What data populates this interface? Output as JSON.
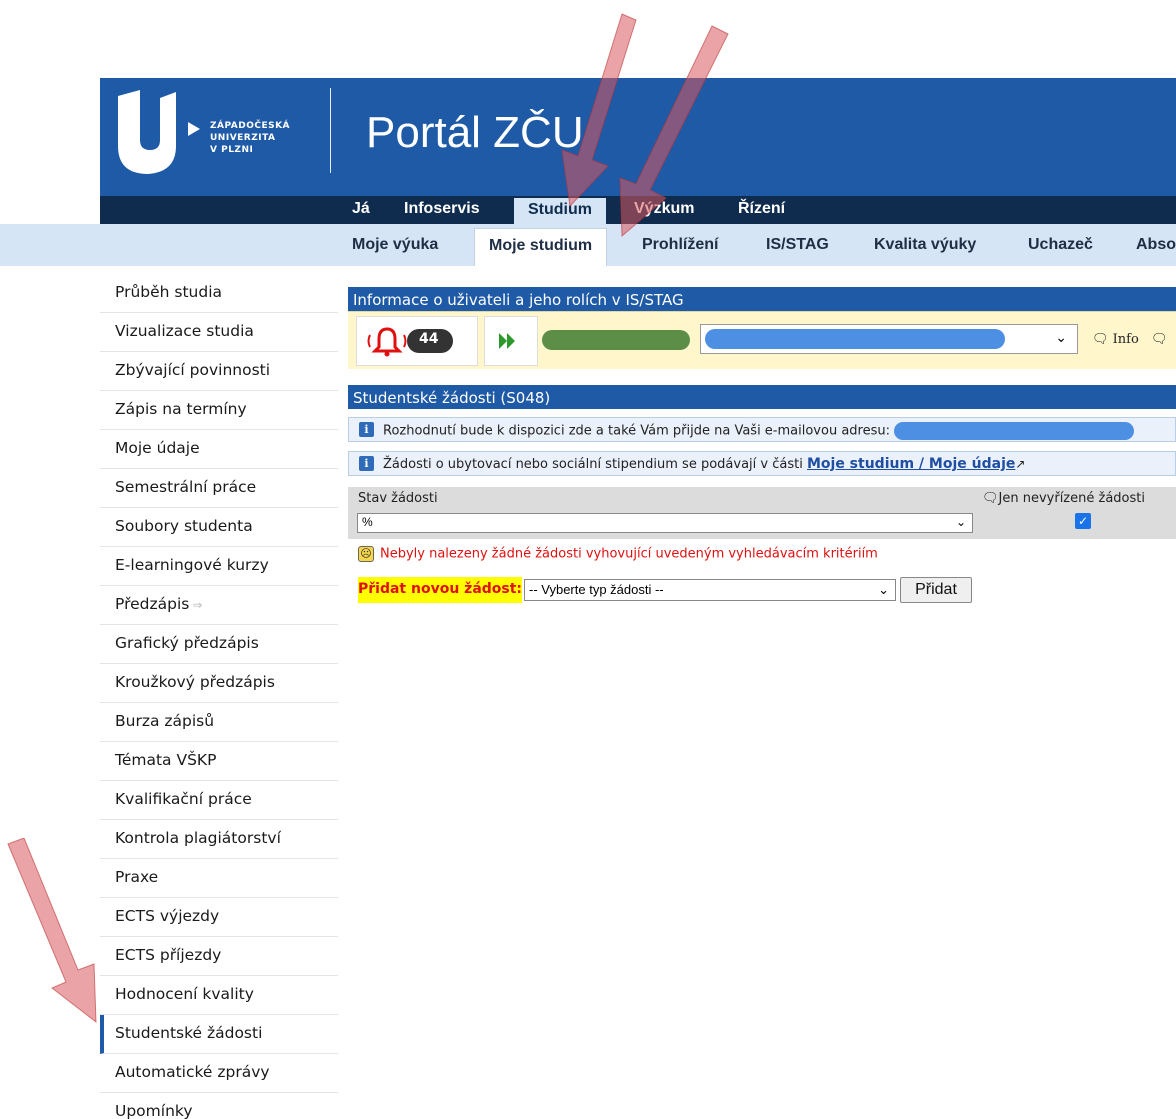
{
  "header": {
    "university_name_lines": [
      "ZÁPADOČESKÁ",
      "UNIVERZITA",
      "V PLZNI"
    ],
    "portal_title": "Portál ZČU"
  },
  "top_nav": [
    {
      "label": "Já",
      "active": false
    },
    {
      "label": "Infoservis",
      "active": false
    },
    {
      "label": "Studium",
      "active": true
    },
    {
      "label": "Výzkum",
      "active": false
    },
    {
      "label": "Řízení",
      "active": false
    }
  ],
  "sub_nav": [
    {
      "label": "Moje výuka",
      "active": false
    },
    {
      "label": "Moje studium",
      "active": true
    },
    {
      "label": "Prohlížení",
      "active": false
    },
    {
      "label": "IS/STAG",
      "active": false
    },
    {
      "label": "Kvalita výuky",
      "active": false
    },
    {
      "label": "Uchazeč",
      "active": false
    },
    {
      "label": "Abso",
      "active": false
    }
  ],
  "sidebar": {
    "items": [
      {
        "label": "Průběh studia"
      },
      {
        "label": "Vizualizace studia"
      },
      {
        "label": "Zbývající povinnosti"
      },
      {
        "label": "Zápis na termíny"
      },
      {
        "label": "Moje údaje"
      },
      {
        "label": "Semestrální práce"
      },
      {
        "label": "Soubory studenta"
      },
      {
        "label": "E-learningové kurzy"
      },
      {
        "label": "Předzápis"
      },
      {
        "label": "Grafický předzápis"
      },
      {
        "label": "Kroužkový předzápis"
      },
      {
        "label": "Burza zápisů"
      },
      {
        "label": "Témata VŠKP"
      },
      {
        "label": "Kvalifikační práce"
      },
      {
        "label": "Kontrola plagiátorství"
      },
      {
        "label": "Praxe"
      },
      {
        "label": "ECTS výjezdy"
      },
      {
        "label": "ECTS příjezdy"
      },
      {
        "label": "Hodnocení kvality"
      },
      {
        "label": "Studentské žádosti"
      },
      {
        "label": "Automatické zprávy"
      },
      {
        "label": "Upomínky"
      }
    ],
    "active_item": "Studentské žádosti"
  },
  "user_panel": {
    "title": "Informace o uživateli a jeho rolích v IS/STAG",
    "notification_count": "44",
    "info_link": "Info"
  },
  "requests_panel": {
    "title": "Studentské žádosti (S048)",
    "message_decision": "Rozhodnutí bude k dispozici zde a také Vám přijde na Vaši e-mailovou adresu:",
    "message_housing": "Žádosti o ubytovací nebo sociální stipendium se podávají v části",
    "message_housing_link": "Moje studium / Moje údaje",
    "status_label": "Stav žádosti",
    "status_value": "%",
    "only_pending_label": "Jen nevyřízené žádosti",
    "only_pending_checked": true,
    "no_results": "Nebyly nalezeny žádné žádosti vyhovující uvedeným vyhledávacím kritériím",
    "add_label": "Přidat novou žádost:",
    "add_select_value": "-- Vyberte typ žádosti --",
    "add_button": "Přidat"
  },
  "colors": {
    "header_blue": "#1f5aa6",
    "nav_dark": "#0f2c4e",
    "subnav_light": "#d6e5f5",
    "error_red": "#e01010",
    "highlight_yellow": "#ffff00",
    "annotation_arrow": "#d9595f"
  }
}
